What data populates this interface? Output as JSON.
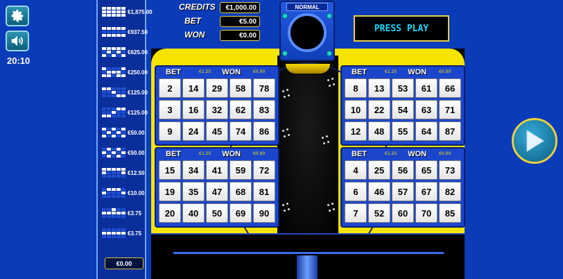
{
  "clock": "20:10",
  "paytable": {
    "rows": [
      {
        "value": "€1,875.00",
        "pattern": [
          1,
          1,
          1,
          1,
          1,
          1,
          1,
          1,
          1,
          1,
          1,
          1,
          1,
          1,
          1
        ]
      },
      {
        "value": "€937.50",
        "pattern": [
          1,
          1,
          1,
          1,
          1,
          0,
          0,
          0,
          0,
          0,
          1,
          1,
          1,
          1,
          1
        ]
      },
      {
        "value": "€625.00",
        "pattern": [
          1,
          1,
          1,
          1,
          1,
          0,
          1,
          0,
          1,
          0,
          1,
          0,
          1,
          0,
          1
        ]
      },
      {
        "value": "€250.00",
        "pattern": [
          1,
          0,
          0,
          0,
          1,
          0,
          1,
          1,
          1,
          0,
          1,
          1,
          0,
          1,
          1
        ]
      },
      {
        "value": "€125.00",
        "pattern": [
          1,
          1,
          0,
          0,
          0,
          0,
          0,
          1,
          0,
          0,
          0,
          0,
          0,
          1,
          1
        ]
      },
      {
        "value": "€125.00",
        "pattern": [
          0,
          0,
          0,
          1,
          1,
          0,
          0,
          1,
          0,
          0,
          1,
          1,
          0,
          0,
          0
        ]
      },
      {
        "value": "€50.00",
        "pattern": [
          1,
          0,
          1,
          0,
          1,
          0,
          1,
          0,
          1,
          0,
          1,
          0,
          1,
          0,
          1
        ]
      },
      {
        "value": "€50.00",
        "pattern": [
          0,
          1,
          0,
          1,
          0,
          1,
          0,
          1,
          0,
          1,
          0,
          1,
          0,
          1,
          0
        ]
      },
      {
        "value": "€12.50",
        "pattern": [
          1,
          1,
          1,
          1,
          1,
          1,
          0,
          0,
          0,
          1,
          0,
          0,
          0,
          0,
          0
        ]
      },
      {
        "value": "€10.00",
        "pattern": [
          0,
          1,
          1,
          1,
          0,
          1,
          0,
          0,
          0,
          1,
          0,
          0,
          0,
          0,
          0
        ]
      },
      {
        "value": "€3.75",
        "pattern": [
          0,
          0,
          1,
          0,
          0,
          1,
          1,
          1,
          1,
          1,
          0,
          0,
          0,
          0,
          0
        ]
      },
      {
        "value": "€3.75",
        "pattern": [
          0,
          0,
          0,
          0,
          0,
          1,
          1,
          1,
          1,
          1,
          0,
          0,
          0,
          0,
          0
        ]
      }
    ],
    "total": "€0.00"
  },
  "info": {
    "credits_label": "CREDITS",
    "credits_value": "€1,000.00",
    "bet_label": "BET",
    "bet_value": "€5.00",
    "won_label": "WON",
    "won_value": "€0.00"
  },
  "mode": "NORMAL",
  "press_play": "PRESS PLAY",
  "cards": [
    {
      "bet_label": "BET",
      "bet_value": "€1.25",
      "won_label": "WON",
      "won_value": "€0.00",
      "numbers": [
        2,
        14,
        29,
        58,
        78,
        3,
        16,
        32,
        62,
        83,
        9,
        24,
        45,
        74,
        86
      ]
    },
    {
      "bet_label": "BET",
      "bet_value": "€1.25",
      "won_label": "WON",
      "won_value": "€0.00",
      "numbers": [
        8,
        13,
        53,
        61,
        66,
        10,
        22,
        54,
        63,
        71,
        12,
        48,
        55,
        64,
        87
      ]
    },
    {
      "bet_label": "BET",
      "bet_value": "€1.25",
      "won_label": "WON",
      "won_value": "€0.00",
      "numbers": [
        15,
        34,
        41,
        59,
        72,
        19,
        35,
        47,
        68,
        81,
        20,
        40,
        50,
        69,
        90
      ]
    },
    {
      "bet_label": "BET",
      "bet_value": "€1.25",
      "won_label": "WON",
      "won_value": "€0.00",
      "numbers": [
        4,
        25,
        56,
        65,
        73,
        6,
        46,
        57,
        67,
        82,
        7,
        52,
        60,
        70,
        85
      ]
    }
  ],
  "icons": {
    "settings": "gear-icon",
    "sound": "speaker-icon",
    "play": "play-icon"
  },
  "colors": {
    "background": "#0a3bb8",
    "machine_yellow": "#f6e400",
    "press_play_text": "#18d8ff"
  }
}
